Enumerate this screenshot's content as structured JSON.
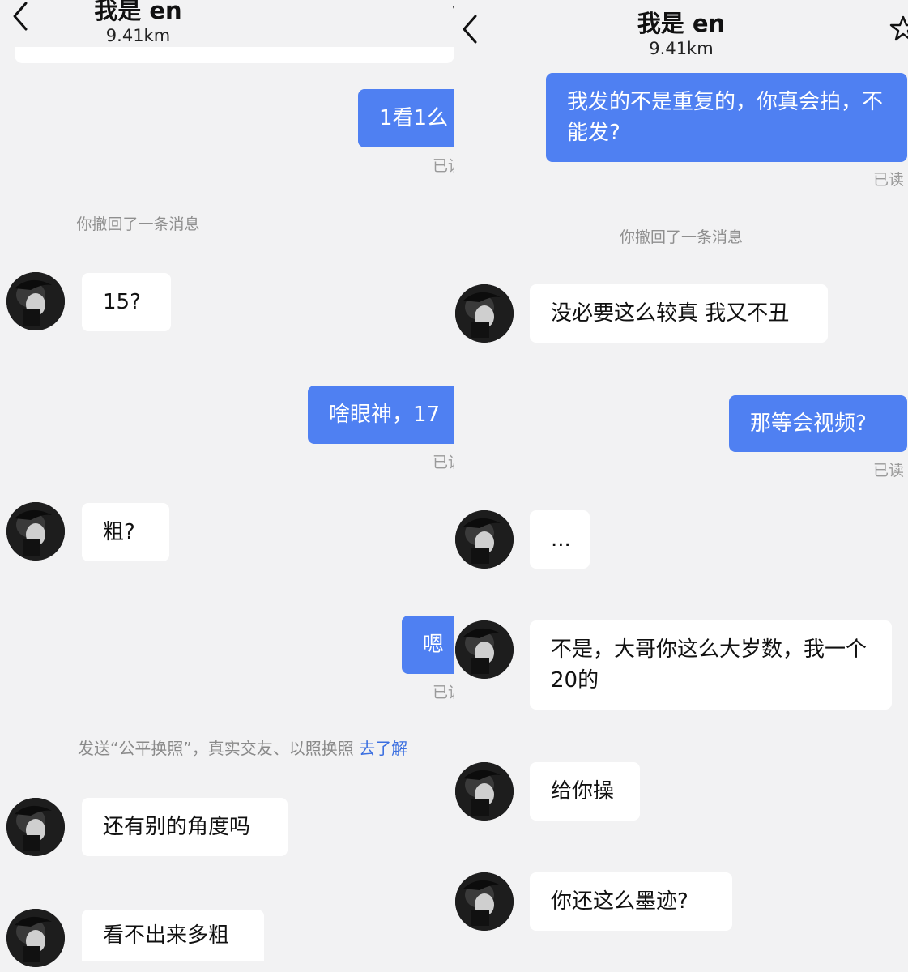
{
  "left": {
    "header": {
      "title": "我是 en",
      "distance": "9.41km"
    },
    "messages": {
      "m1": "1看1么",
      "m1_read": "已读",
      "recall": "你撤回了一条消息",
      "m2": "15?",
      "m3": "啥眼神，17",
      "m3_read": "已读",
      "m4": "粗?",
      "m5": "嗯",
      "m5_read": "已读",
      "promo_text": "发送“公平换照”，真实交友、以照换照",
      "promo_link": "去了解",
      "m6": "还有别的角度吗",
      "m7": "看不出来多粗"
    }
  },
  "right": {
    "header": {
      "title": "我是 en",
      "distance": "9.41km"
    },
    "messages": {
      "r1": "我发的不是重复的，你真会拍，不能发?",
      "r1_read": "已读",
      "recall": "你撤回了一条消息",
      "r2": "没必要这么较真 我又不丑",
      "r3": "那等会视频?",
      "r3_read": "已读",
      "r4": "...",
      "r5": "不是，大哥你这么大岁数，我一个20的",
      "r6": "给你操",
      "r7": "你还这么墨迹?"
    }
  },
  "icons": {
    "back": "chevron-left-icon",
    "favorite": "star-icon"
  },
  "colors": {
    "outgoing_bubble": "#4f80f2",
    "incoming_bubble": "#ffffff",
    "background": "#f2f2f3",
    "link": "#3b6fe0"
  }
}
